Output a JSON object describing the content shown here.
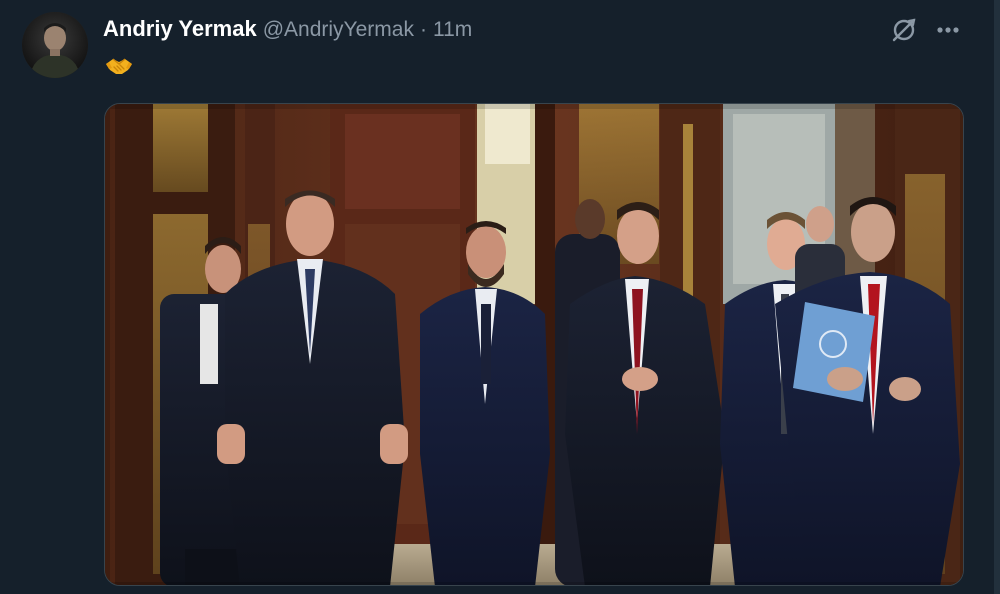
{
  "tweet": {
    "author": {
      "display_name": "Andriy Yermak",
      "handle": "@AndriyYermak"
    },
    "separator": "·",
    "timestamp": "11m",
    "body_emoji": "handshake"
  },
  "icons": {
    "grok": "grok-icon",
    "more": "more-icon"
  },
  "colors": {
    "background": "#15202b",
    "name": "#ffffff",
    "secondary_text": "#8b98a5",
    "media_border": "#38444d"
  }
}
